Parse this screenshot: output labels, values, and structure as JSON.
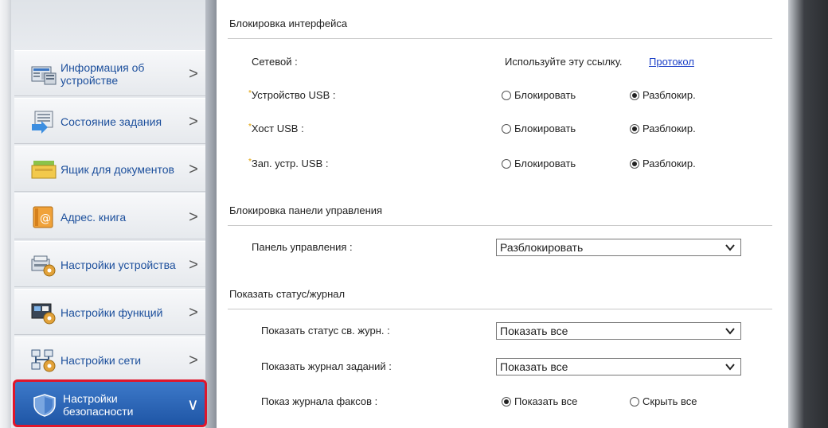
{
  "sidebar": {
    "items": [
      {
        "label": "Информация об устройстве",
        "icon": "device-info-icon",
        "chevron": ">"
      },
      {
        "label": "Состояние задания",
        "icon": "job-status-icon",
        "chevron": ">"
      },
      {
        "label": "Ящик для документов",
        "icon": "document-box-icon",
        "chevron": ">"
      },
      {
        "label": "Адрес. книга",
        "icon": "address-book-icon",
        "chevron": ">"
      },
      {
        "label": "Настройки устройства",
        "icon": "device-settings-icon",
        "chevron": ">"
      },
      {
        "label": "Настройки функций",
        "icon": "function-settings-icon",
        "chevron": ">"
      },
      {
        "label": "Настройки сети",
        "icon": "network-settings-icon",
        "chevron": ">"
      },
      {
        "label": "Настройки безопасности",
        "icon": "security-shield-icon",
        "chevron": "∨"
      }
    ]
  },
  "main": {
    "interface_lock": {
      "title": "Блокировка интерфейса",
      "network_label": "Сетевой :",
      "network_text": "Используйте эту ссылку.",
      "network_link": "Протокол",
      "rows": [
        {
          "label": "Устройство USB :",
          "opt1": "Блокировать",
          "opt2": "Разблокир.",
          "selected": "opt2"
        },
        {
          "label": "Хост USB :",
          "opt1": "Блокировать",
          "opt2": "Разблокир.",
          "selected": "opt2"
        },
        {
          "label": "Зап. устр. USB :",
          "opt1": "Блокировать",
          "opt2": "Разблокир.",
          "selected": "opt2"
        }
      ]
    },
    "panel_lock": {
      "title": "Блокировка панели управления",
      "label": "Панель управления :",
      "value": "Разблокировать"
    },
    "status_log": {
      "title": "Показать статус/журнал",
      "status_label": "Показать статус св. журн. :",
      "status_value": "Показать все",
      "job_log_label": "Показать журнал заданий :",
      "job_log_value": "Показать все",
      "fax_log_label": "Показ журнала факсов :",
      "fax_opt1": "Показать все",
      "fax_opt2": "Скрыть все",
      "fax_selected": "opt1"
    }
  },
  "colors": {
    "link": "#1a3fc7",
    "active_nav": "#2a63b5",
    "highlight_border": "#e0162b",
    "required_mark": "#e0a000"
  }
}
